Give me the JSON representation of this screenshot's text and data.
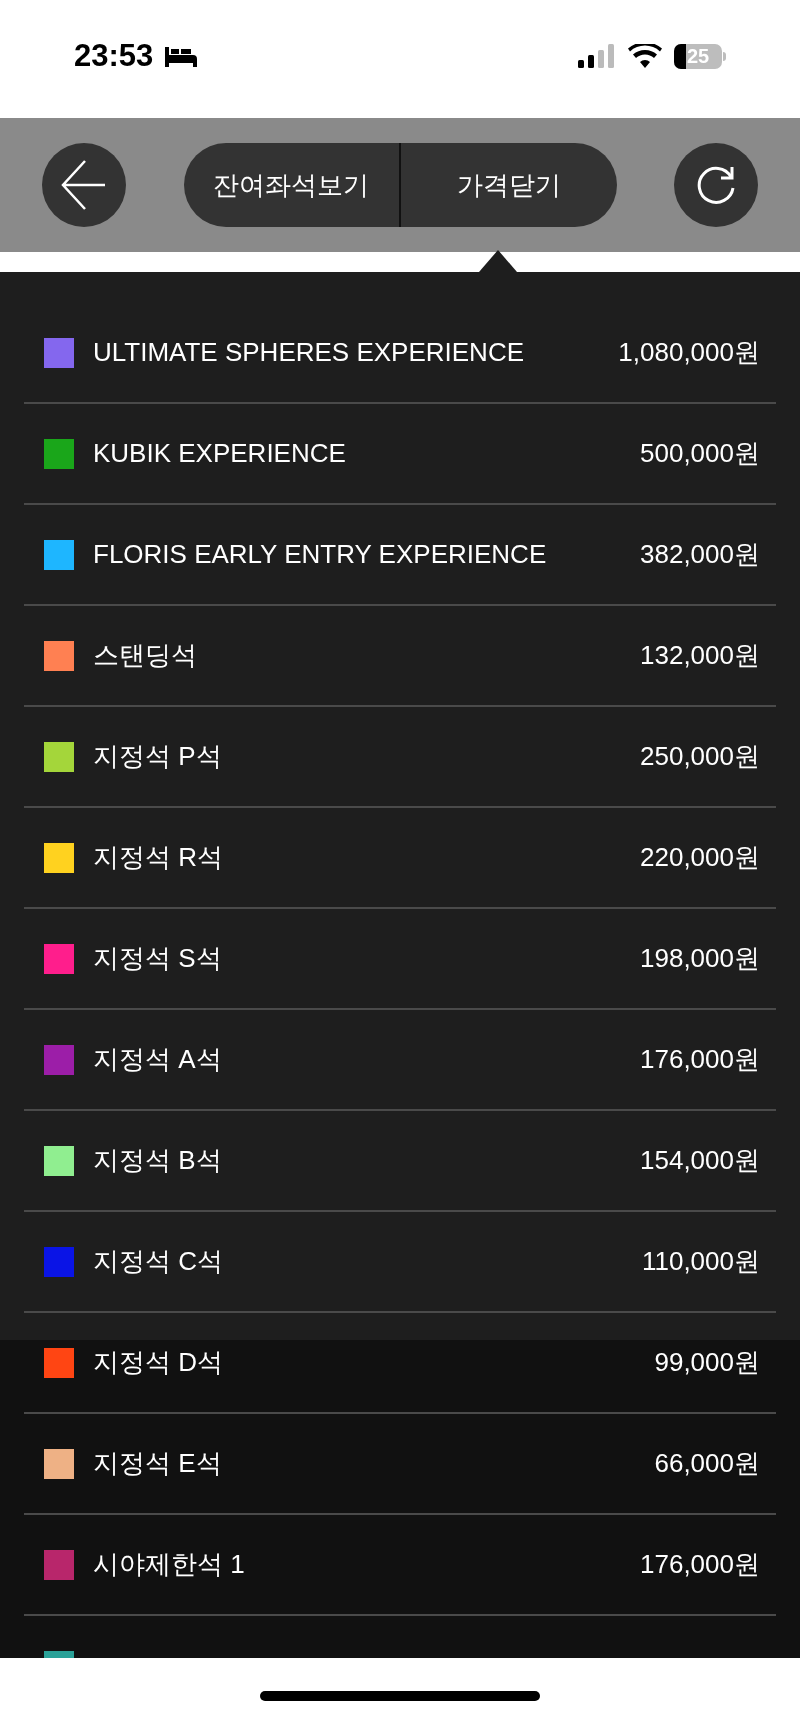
{
  "status_bar": {
    "time": "23:53",
    "battery": "25"
  },
  "toolbar": {
    "buttons": [
      "잔여좌석보기",
      "가격닫기"
    ]
  },
  "prices": [
    {
      "label": "ULTIMATE SPHERES EXPERIENCE",
      "price": "1,080,000원",
      "color": "#8467ee"
    },
    {
      "label": "KUBIK EXPERIENCE",
      "price": "500,000원",
      "color": "#1aa61a"
    },
    {
      "label": "FLORIS EARLY ENTRY EXPERIENCE",
      "price": "382,000원",
      "color": "#1eb6ff"
    },
    {
      "label": "스탠딩석",
      "price": "132,000원",
      "color": "#ff8052"
    },
    {
      "label": "지정석 P석",
      "price": "250,000원",
      "color": "#a4d63a"
    },
    {
      "label": "지정석 R석",
      "price": "220,000원",
      "color": "#ffd21f"
    },
    {
      "label": "지정석 S석",
      "price": "198,000원",
      "color": "#ff1e8c"
    },
    {
      "label": "지정석 A석",
      "price": "176,000원",
      "color": "#9c1ea8"
    },
    {
      "label": "지정석 B석",
      "price": "154,000원",
      "color": "#90ee90"
    },
    {
      "label": "지정석 C석",
      "price": "110,000원",
      "color": "#0a14e6"
    },
    {
      "label": "지정석 D석",
      "price": "99,000원",
      "color": "#ff4513"
    },
    {
      "label": "지정석 E석",
      "price": "66,000원",
      "color": "#eeb185"
    },
    {
      "label": "시야제한석 1",
      "price": "176,000원",
      "color": "#b8266b"
    },
    {
      "color": "#2aa198"
    }
  ]
}
